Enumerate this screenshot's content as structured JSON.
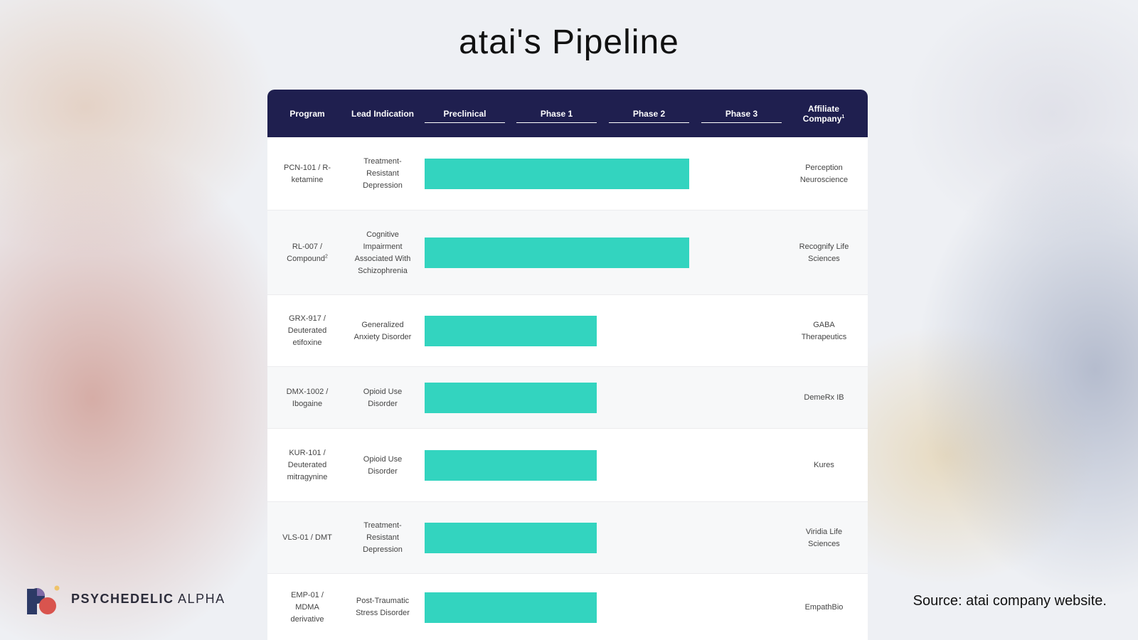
{
  "title": "atai's Pipeline",
  "chart_data": {
    "type": "table",
    "columns": [
      "Program",
      "Lead Indication",
      "Preclinical",
      "Phase 1",
      "Phase 2",
      "Phase 3",
      "Affiliate Company"
    ],
    "affiliate_sup": "1",
    "stages": [
      "Preclinical",
      "Phase 1",
      "Phase 2",
      "Phase 3"
    ],
    "bar_color": "#33d4bf",
    "header_color": "#1f1f4f",
    "rows": [
      {
        "program": "PCN-101 / R-ketamine",
        "indication": "Treatment-Resistant Depression",
        "affiliate": "Perception Neuroscience",
        "progress_stages": 3
      },
      {
        "program": "RL-007 / Compound",
        "program_sup": "2",
        "indication": "Cognitive Impairment Associated With Schizophrenia",
        "affiliate": "Recognify Life Sciences",
        "progress_stages": 3
      },
      {
        "program": "GRX-917 / Deuterated etifoxine",
        "indication": "Generalized Anxiety Disorder",
        "affiliate": "GABA Therapeutics",
        "progress_stages": 2
      },
      {
        "program": "DMX-1002 / Ibogaine",
        "indication": "Opioid Use Disorder",
        "affiliate": "DemeRx IB",
        "progress_stages": 2
      },
      {
        "program": "KUR-101 / Deuterated mitragynine",
        "indication": "Opioid Use Disorder",
        "affiliate": "Kures",
        "progress_stages": 2
      },
      {
        "program": "VLS-01 / DMT",
        "indication": "Treatment-Resistant Depression",
        "affiliate": "Viridia Life Sciences",
        "progress_stages": 2
      },
      {
        "program": "EMP-01 / MDMA derivative",
        "indication": "Post-Traumatic Stress Disorder",
        "affiliate": "EmpathBio",
        "progress_stages": 2
      }
    ]
  },
  "brand": {
    "part1": "PSYCHEDELIC",
    "part2": "ALPHA"
  },
  "source": "Source: atai company website."
}
